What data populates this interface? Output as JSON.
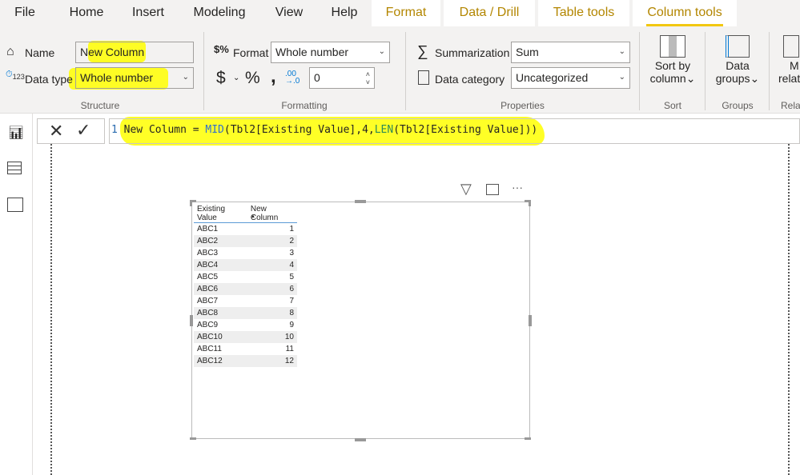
{
  "tabs": [
    {
      "label": "File"
    },
    {
      "label": "Home"
    },
    {
      "label": "Insert"
    },
    {
      "label": "Modeling"
    },
    {
      "label": "View"
    },
    {
      "label": "Help"
    },
    {
      "label": "Format"
    },
    {
      "label": "Data / Drill"
    },
    {
      "label": "Table tools"
    },
    {
      "label": "Column tools",
      "active": true
    }
  ],
  "colors": {
    "contextual_tab": "#b38600",
    "active_underline": "#f2c811",
    "highlight": "#ffff00"
  },
  "structure": {
    "name_label": "Name",
    "name_value": "New Column",
    "datatype_label": "Data type",
    "datatype_value": "Whole number",
    "group": "Structure"
  },
  "formatting": {
    "format_label": "Format",
    "format_value": "Whole number",
    "currency": "$",
    "percent": "%",
    "comma": ",",
    "decimals": "0",
    "group": "Formatting"
  },
  "properties": {
    "summarization_label": "Summarization",
    "summarization_value": "Sum",
    "category_label": "Data category",
    "category_value": "Uncategorized",
    "group": "Properties"
  },
  "sort": {
    "button": "Sort by",
    "button2": "column",
    "group": "Sort"
  },
  "groups": {
    "button": "Data",
    "button2": "groups",
    "group": "Groups"
  },
  "relationships": {
    "button": "M",
    "button2": "relat",
    "group": "Rela"
  },
  "formula": {
    "line": "1",
    "p1": "New Column = ",
    "fn1": "MID",
    "p2": "(Tbl2[Existing Value],4,",
    "fn2": "LEN",
    "p3": "(Tbl2[Existing Value]))"
  },
  "visual": {
    "headers": [
      "Existing Value",
      "New Column"
    ],
    "rows": [
      [
        "ABC1",
        "1"
      ],
      [
        "ABC2",
        "2"
      ],
      [
        "ABC3",
        "3"
      ],
      [
        "ABC4",
        "4"
      ],
      [
        "ABC5",
        "5"
      ],
      [
        "ABC6",
        "6"
      ],
      [
        "ABC7",
        "7"
      ],
      [
        "ABC8",
        "8"
      ],
      [
        "ABC9",
        "9"
      ],
      [
        "ABC10",
        "10"
      ],
      [
        "ABC11",
        "11"
      ],
      [
        "ABC12",
        "12"
      ]
    ]
  }
}
